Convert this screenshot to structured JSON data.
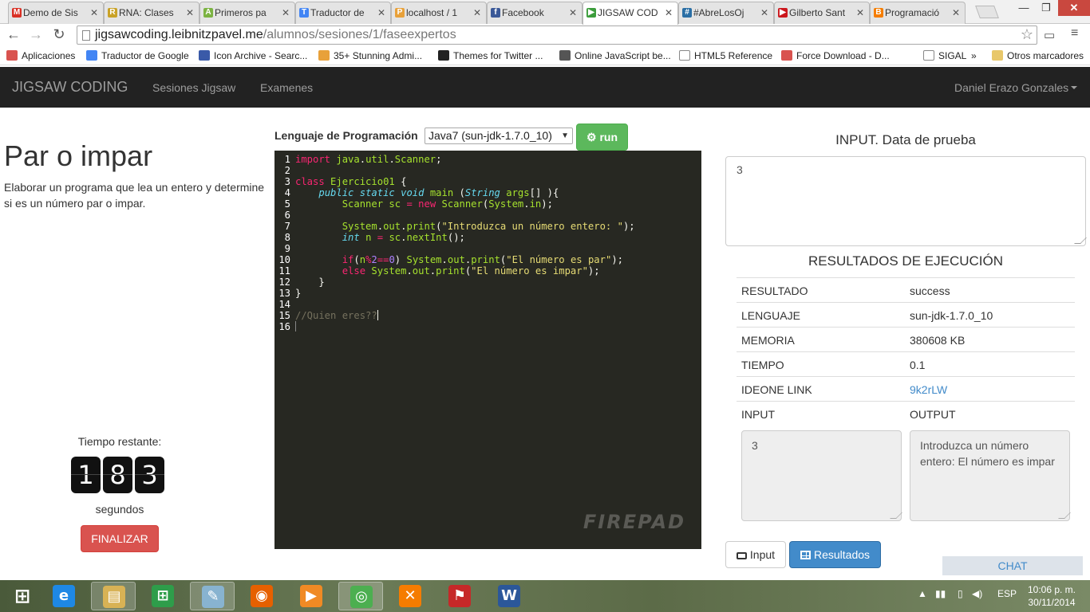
{
  "browser": {
    "tabs": [
      {
        "label": "Demo de Sis",
        "icon": "gmail-icon",
        "color": "#d93025",
        "glyph": "M"
      },
      {
        "label": "RNA: Clases",
        "icon": "rna-icon",
        "color": "#c9a227",
        "glyph": "R"
      },
      {
        "label": "Primeros pa",
        "icon": "android-icon",
        "color": "#7cb342",
        "glyph": "A"
      },
      {
        "label": "Traductor de",
        "icon": "translate-icon",
        "color": "#4285f4",
        "glyph": "T"
      },
      {
        "label": "localhost / 1",
        "icon": "phpmyadmin-icon",
        "color": "#e8a13a",
        "glyph": "P"
      },
      {
        "label": "Facebook",
        "icon": "facebook-icon",
        "color": "#3b5998",
        "glyph": "f"
      },
      {
        "label": "JIGSAW COD",
        "icon": "play-icon",
        "color": "#3c9d3c",
        "glyph": "▶"
      },
      {
        "label": "#AbreLosOj",
        "icon": "twitter-icon",
        "color": "#2b6fa5",
        "glyph": "#"
      },
      {
        "label": "Gilberto Sant",
        "icon": "youtube-icon",
        "color": "#cc181e",
        "glyph": "▶"
      },
      {
        "label": "Programació",
        "icon": "blogger-icon",
        "color": "#f57d00",
        "glyph": "B"
      }
    ],
    "active_tab": 6,
    "url_host": "jigsawcoding.leibnitzpavel.me",
    "url_path": "/alumnos/sesiones/1/faseexpertos",
    "bookmarks": [
      {
        "label": "Aplicaciones",
        "icon": "apps-grid-icon",
        "color": "#d9534f"
      },
      {
        "label": "Traductor de Google",
        "icon": "translate-icon",
        "color": "#4285f4"
      },
      {
        "label": "Icon Archive - Searc...",
        "icon": "star-badge-icon",
        "color": "#3a5aa8"
      },
      {
        "label": "35+ Stunning Admi...",
        "icon": "tw-icon",
        "color": "#e8a13a"
      },
      {
        "label": "Themes for Twitter ...",
        "icon": "w-badge-icon",
        "color": "#222222"
      },
      {
        "label": "Online JavaScript be...",
        "icon": "octocat-icon",
        "color": "#555555"
      },
      {
        "label": "HTML5 Reference",
        "icon": "page-icon",
        "color": "#ffffff"
      },
      {
        "label": "Force Download - D...",
        "icon": "fd-icon",
        "color": "#d9534f"
      },
      {
        "label": "SIGAL",
        "icon": "page-icon",
        "color": "#ffffff"
      },
      {
        "label": "»",
        "icon": "",
        "color": ""
      },
      {
        "label": "Otros marcadores",
        "icon": "folder-icon",
        "color": "#e8c76a"
      }
    ]
  },
  "nav": {
    "brand": "JIGSAW CODING",
    "links": [
      "Sesiones Jigsaw",
      "Examenes"
    ],
    "user": "Daniel Erazo Gonzales"
  },
  "exercise": {
    "title": "Par o impar",
    "description": "Elaborar un programa que lea un entero y determine si es un número par o impar."
  },
  "timer": {
    "label": "Tiempo restante:",
    "digits": [
      "1",
      "8",
      "3"
    ],
    "unit": "segundos",
    "finish_label": "FINALIZAR"
  },
  "editor": {
    "language_label": "Lenguaje de Programación",
    "language_selected": "Java7 (sun-jdk-1.7.0_10)",
    "run_label": "run",
    "watermark": "FIREPAD",
    "lines": [
      "import java.util.Scanner;",
      "",
      "class Ejercicio01 {",
      "    public static void main (String args[] ){",
      "        Scanner sc = new Scanner(System.in);",
      "",
      "        System.out.print(\"Introduzca un número entero: \");",
      "        int n = sc.nextInt();",
      "",
      "        if(n%2==0) System.out.print(\"El número es par\");",
      "        else System.out.print(\"El número es impar\");",
      "    }",
      "}",
      "",
      "//Quien eres??",
      ""
    ]
  },
  "input_panel": {
    "heading": "INPUT. Data de prueba",
    "value": "3"
  },
  "results": {
    "heading": "RESULTADOS DE EJECUCIÓN",
    "rows": [
      {
        "key": "RESULTADO",
        "value": "success"
      },
      {
        "key": "LENGUAJE",
        "value": "sun-jdk-1.7.0_10"
      },
      {
        "key": "MEMORIA",
        "value": "380608 KB"
      },
      {
        "key": "TIEMPO",
        "value": "0.1"
      },
      {
        "key": "IDEONE LINK",
        "value": "9k2rLW"
      },
      {
        "key": "INPUT",
        "value": "OUTPUT"
      }
    ],
    "input_value": "3",
    "output_value": "Introduzca un número entero: El número es impar"
  },
  "bottom_buttons": {
    "input_label": "Input",
    "results_label": "Resultados",
    "chat_label": "CHAT"
  },
  "taskbar": {
    "language": "ESP",
    "time": "10:06 p. m.",
    "date": "30/11/2014",
    "apps": [
      "start-icon",
      "ie-icon",
      "file-explorer-icon",
      "store-icon",
      "notepad-icon",
      "firefox-icon",
      "media-player-icon",
      "chrome-icon",
      "xampp-icon",
      "acrobat-icon",
      "word-icon"
    ]
  }
}
